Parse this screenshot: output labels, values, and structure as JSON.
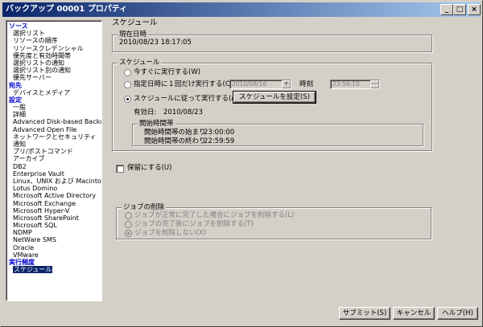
{
  "window": {
    "title": "バックアップ 00001 プロパティ",
    "minimize_glyph": "_",
    "maximize_glyph": "□",
    "close_glyph": "×"
  },
  "sidebar": {
    "items": [
      {
        "label": "ソース",
        "kind": "cat"
      },
      {
        "label": "選択リスト",
        "kind": "sub"
      },
      {
        "label": "リソースの順序",
        "kind": "sub"
      },
      {
        "label": "リソースクレデンシャル",
        "kind": "sub"
      },
      {
        "label": "優先度と有効時間帯",
        "kind": "sub"
      },
      {
        "label": "選択リストの通知",
        "kind": "sub"
      },
      {
        "label": "選択リスト別の通知",
        "kind": "sub"
      },
      {
        "label": "優先サーバー",
        "kind": "sub"
      },
      {
        "label": "宛先",
        "kind": "cat"
      },
      {
        "label": "デバイスとメディア",
        "kind": "sub"
      },
      {
        "label": "設定",
        "kind": "cat"
      },
      {
        "label": "一般",
        "kind": "sub"
      },
      {
        "label": "詳細",
        "kind": "sub"
      },
      {
        "label": "Advanced Disk-based Backup",
        "kind": "sub"
      },
      {
        "label": "Advanced Open File",
        "kind": "sub"
      },
      {
        "label": "ネットワークとセキュリティ",
        "kind": "sub"
      },
      {
        "label": "通知",
        "kind": "sub"
      },
      {
        "label": "プリ/ポストコマンド",
        "kind": "sub"
      },
      {
        "label": "アーカイブ",
        "kind": "sub"
      },
      {
        "label": "DB2",
        "kind": "sub"
      },
      {
        "label": "Enterprise Vault",
        "kind": "sub"
      },
      {
        "label": "Linux、UNIX および Macintosh",
        "kind": "sub"
      },
      {
        "label": "Lotus Domino",
        "kind": "sub"
      },
      {
        "label": "Microsoft Active Directory",
        "kind": "sub"
      },
      {
        "label": "Microsoft Exchange",
        "kind": "sub"
      },
      {
        "label": "Microsoft Hyper-V",
        "kind": "sub"
      },
      {
        "label": "Microsoft SharePoint",
        "kind": "sub"
      },
      {
        "label": "Microsoft SQL",
        "kind": "sub"
      },
      {
        "label": "NDMP",
        "kind": "sub"
      },
      {
        "label": "NetWare SMS",
        "kind": "sub"
      },
      {
        "label": "Oracle",
        "kind": "sub"
      },
      {
        "label": "VMware",
        "kind": "sub"
      },
      {
        "label": "実行頻度",
        "kind": "cat"
      },
      {
        "label": "スケジュール",
        "kind": "sel"
      }
    ]
  },
  "schedule_page": {
    "heading": "スケジュール",
    "current_datetime": {
      "legend": "現在日時",
      "value": "2010/08/23 18:17:05"
    },
    "schedule_group": {
      "legend": "スケジュール",
      "radio_now": "今すぐに実行する(W)",
      "radio_once": "指定日時に１回だけ実行する(O)",
      "once_date": "2010/08/16",
      "time_label": "時刻",
      "once_time": "23:56:10",
      "radio_schedule": "スケジュールに従って実行する(A)",
      "set_schedule_button": "スケジュールを設定(S)",
      "effective_label": "有効日:",
      "effective_date": "2010/08/23",
      "window_group": {
        "legend": "開始時間帯",
        "start_label": "開始時間帯の始まり",
        "start_value": "23:00:00",
        "end_label": "開始時間帯の終わり",
        "end_value": "22:59:59"
      }
    },
    "hold_checkbox": "保留にする(U)",
    "delete_group": {
      "legend": "ジョブの削除",
      "option1": "ジョブが正常に完了した場合にジョブを削除する(L)",
      "option2": "ジョブの完了後にジョブを削除する(T)",
      "option3": "ジョブを削除しない(X)"
    }
  },
  "footer": {
    "submit": "サブミット(S)",
    "cancel": "キャンセル",
    "help": "ヘルプ(H)"
  }
}
